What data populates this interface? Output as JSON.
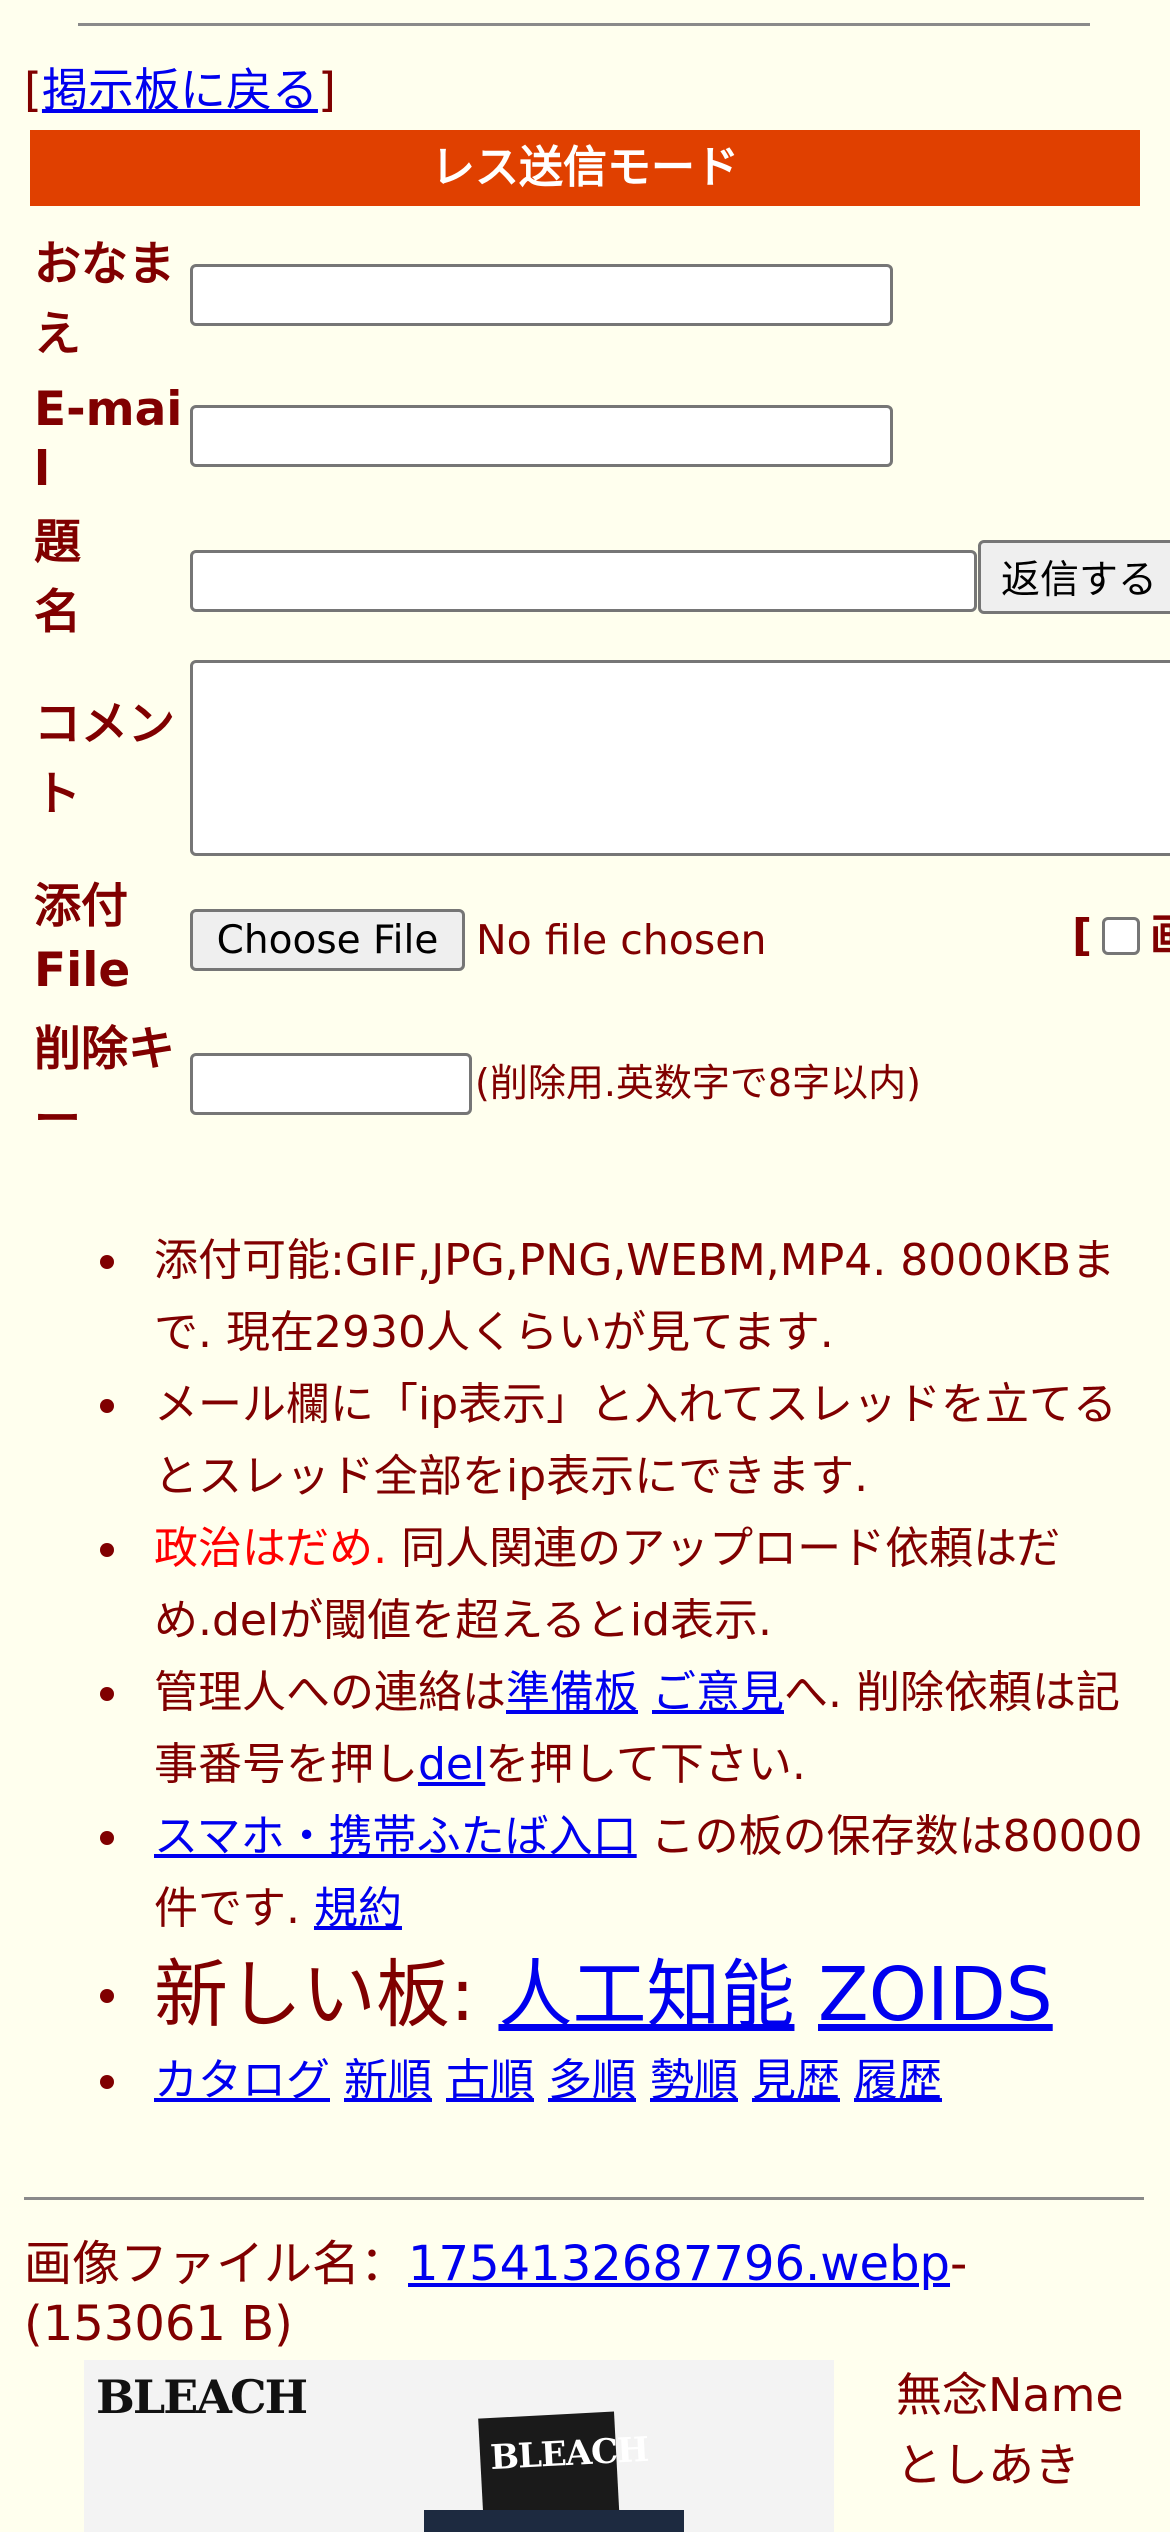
{
  "nav": {
    "open_bracket": "[",
    "back_link": "掲示板に戻る",
    "close_bracket": "]"
  },
  "form": {
    "mode_title": "レス送信モード",
    "name_label": "おなまえ",
    "email_label": "E-mail",
    "subject_label": "題名",
    "comment_label": "コメント",
    "file_label": "添付File",
    "delkey_label": "削除キー",
    "submit_button": "返信する",
    "choose_file_button": "Choose File",
    "file_status": "No file chosen",
    "image_option_bracket": "[",
    "image_option_label": "画",
    "delkey_note": "(削除用.英数字で8字以内)"
  },
  "notes": {
    "n1": "添付可能:GIF,JPG,PNG,WEBM,MP4. 8000KBまで. 現在2930人くらいが見てます.",
    "n2": "メール欄に「ip表示」と入れてスレッドを立てるとスレッド全部をip表示にできます.",
    "n3_red": "政治はだめ.",
    "n3_rest": " 同人関連のアップロード依頼はだめ.delが閾値を超えるとid表示.",
    "n4_pre": "管理人への連絡は",
    "n4_link1": "準備板",
    "n4_space": " ",
    "n4_link2": "ご意見",
    "n4_mid": "へ. 削除依頼は記事番号を押し",
    "n4_link3": "del",
    "n4_post": "を押して下さい.",
    "n5_link": "スマホ・携帯ふたば入口",
    "n5_text": " この板の保存数は80000件です. ",
    "n5_link2": "規約",
    "n6_label": "新しい板: ",
    "n6_link1": "人工知能",
    "n6_link2": "ZOIDS",
    "n7_links": [
      "カタログ",
      "新順",
      "古順",
      "多順",
      "勢順",
      "見歴",
      "履歴"
    ]
  },
  "post": {
    "filename_label": "画像ファイル名：",
    "filename_link": "1754132687796.webp",
    "filesize": "-(153061 B)",
    "thumb_logo": "BLEACH",
    "thumb_card_logo": "BLEACH",
    "subject": "無念",
    "name": "Name",
    "author": "としあき"
  }
}
